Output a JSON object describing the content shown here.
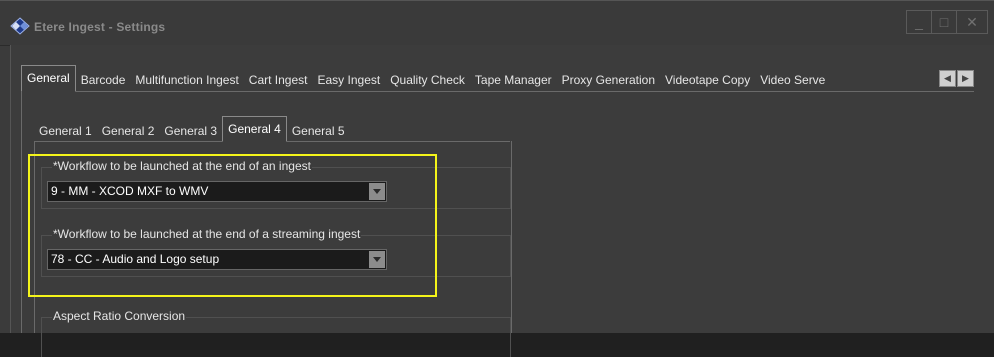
{
  "window": {
    "title": "Etere Ingest - Settings",
    "controls": [
      "_",
      "□",
      "✕"
    ]
  },
  "main_tabs": [
    {
      "label": "General",
      "active": true
    },
    {
      "label": "Barcode"
    },
    {
      "label": "Multifunction Ingest"
    },
    {
      "label": "Cart Ingest"
    },
    {
      "label": "Easy Ingest"
    },
    {
      "label": "Quality Check"
    },
    {
      "label": "Tape Manager"
    },
    {
      "label": "Proxy Generation"
    },
    {
      "label": "Videotape Copy"
    },
    {
      "label": "Video Serve"
    }
  ],
  "sub_tabs": [
    {
      "label": "General 1"
    },
    {
      "label": "General 2"
    },
    {
      "label": "General 3"
    },
    {
      "label": "General 4",
      "active": true
    },
    {
      "label": "General 5"
    }
  ],
  "groups": {
    "ingest_workflow": {
      "label": "*Workflow to be launched at the end of an ingest",
      "value": "9 - MM - XCOD MXF to WMV"
    },
    "streaming_workflow": {
      "label": "*Workflow to be launched at the end of a streaming ingest",
      "value": "78 - CC - Audio and Logo setup"
    },
    "aspect_ratio": {
      "label": "Aspect Ratio Conversion"
    }
  },
  "colors": {
    "highlight": "#f4f41a",
    "background": "#3c3c3c"
  }
}
